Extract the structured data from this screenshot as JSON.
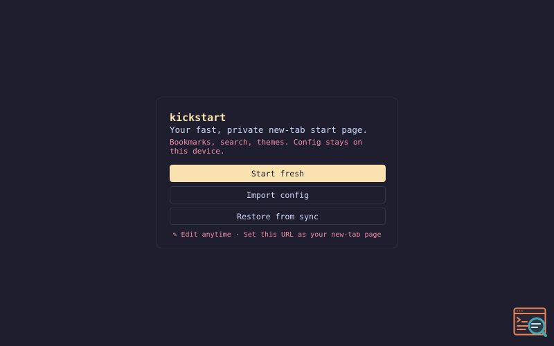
{
  "app": {
    "title": "kickstart",
    "tagline": "Your fast, private new-tab start page.",
    "description": "Bookmarks, search, themes. Config stays on this device."
  },
  "actions": {
    "start_fresh": "Start fresh",
    "import_config": "Import config",
    "restore_sync": "Restore from sync"
  },
  "footer": {
    "edit_icon": "✎",
    "edit_text": "Edit anytime",
    "separator": "·",
    "newtab_text": "Set this URL as your new-tab page"
  },
  "helper": {
    "icon": "terminal-search-icon"
  },
  "colors": {
    "background": "#1e1e2e",
    "accent_yellow": "#f9e2af",
    "accent_pink": "#f38ba8",
    "text": "#cdd6f4",
    "helper_orange": "#e8875a",
    "helper_teal": "#4aa6b0"
  }
}
